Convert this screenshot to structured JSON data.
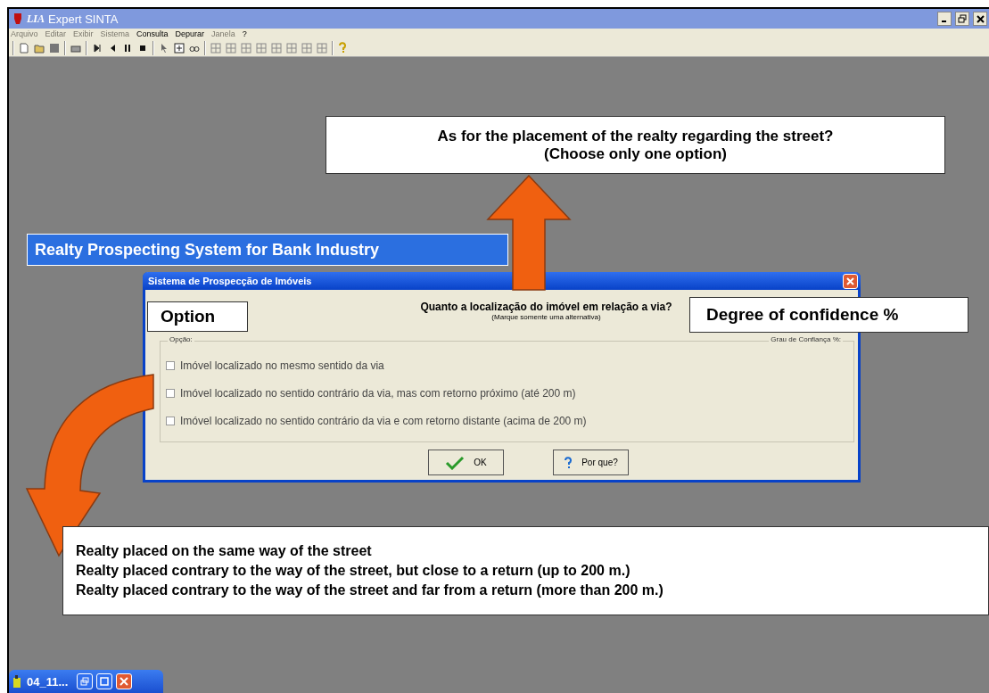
{
  "window": {
    "title": "Expert SINTA",
    "logo_text": "LIA"
  },
  "menu": [
    {
      "label": "Arquivo",
      "disabled": true
    },
    {
      "label": "Editar",
      "disabled": true
    },
    {
      "label": "Exibir",
      "disabled": true
    },
    {
      "label": "Sistema",
      "disabled": true
    },
    {
      "label": "Consulta",
      "disabled": false
    },
    {
      "label": "Depurar",
      "disabled": false
    },
    {
      "label": "Janela",
      "disabled": true
    },
    {
      "label": "?",
      "disabled": false
    }
  ],
  "dialog": {
    "title": "Sistema de Prospecção de Imóveis",
    "question": "Quanto a localização do imóvel em relação a via?",
    "hint": "(Marque somente uma alternativa)",
    "group_label": "Opção:",
    "confidence_label": "Grau de Confiança %:",
    "options": [
      {
        "label": "Imóvel localizado no mesmo sentido da via",
        "checked": false
      },
      {
        "label": "Imóvel localizado no sentido contrário da via, mas com retorno próximo (até 200 m)",
        "checked": false
      },
      {
        "label": "Imóvel localizado no sentido contrário da via e com retorno distante (acima de 200 m)",
        "checked": false
      }
    ],
    "buttons": [
      {
        "kind": "ok",
        "label": "OK"
      },
      {
        "kind": "help",
        "label": "Por que?"
      }
    ]
  },
  "annotations": {
    "question_box": [
      "As for the placement of the realty regarding the street?",
      "(Choose only one option)"
    ],
    "banner": "Realty Prospecting System for Bank Industry",
    "option_label": "Option",
    "confidence_label": "Degree of confidence %",
    "options_box": [
      "Realty placed on the same way of the street",
      "Realty placed contrary to the way of the street, but close to a return (up to 200 m.)",
      "Realty placed contrary to the way of the street and far from a return (more than 200 m.)"
    ]
  },
  "taskbar": {
    "label": "04_11..."
  }
}
